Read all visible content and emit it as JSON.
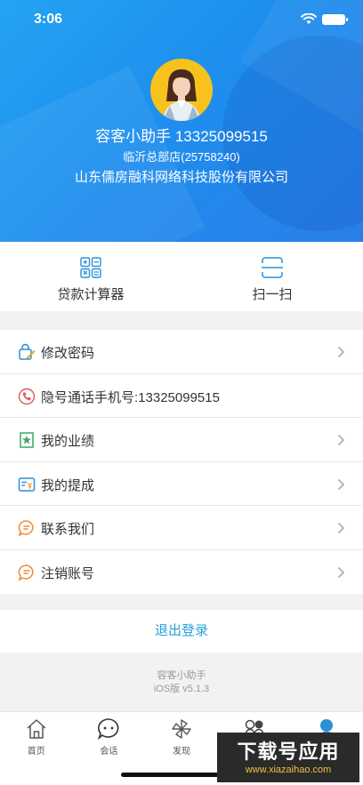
{
  "status_bar": {
    "time": "3:06"
  },
  "profile": {
    "name_line": "容客小助手  13325099515",
    "store": "临沂总部店(25758240)",
    "company": "山东儒房融科网络科技股份有限公司"
  },
  "tools": [
    {
      "label": "贷款计算器",
      "icon": "calculator-icon"
    },
    {
      "label": "扫一扫",
      "icon": "scan-icon"
    }
  ],
  "menu": [
    {
      "label": "修改密码",
      "icon": "edit-lock-icon",
      "arrow": true
    },
    {
      "label": "隐号通话手机号:13325099515",
      "icon": "phone-icon",
      "arrow": false
    },
    {
      "label": "我的业绩",
      "icon": "performance-icon",
      "arrow": true
    },
    {
      "label": "我的提成",
      "icon": "commission-icon",
      "arrow": true
    },
    {
      "label": "联系我们",
      "icon": "chat-icon",
      "arrow": true
    },
    {
      "label": "注销账号",
      "icon": "chat-icon",
      "arrow": true
    }
  ],
  "logout_label": "退出登录",
  "footer": {
    "app_name": "容客小助手",
    "version": "iOS版 v5.1.3"
  },
  "tabbar": [
    {
      "label": "首页",
      "icon": "home-icon"
    },
    {
      "label": "会话",
      "icon": "message-icon"
    },
    {
      "label": "发现",
      "icon": "pinwheel-icon"
    },
    {
      "label": "",
      "icon": "apps-icon"
    },
    {
      "label": "",
      "icon": "profile-icon",
      "active": true
    }
  ],
  "watermark": {
    "title": "下载号应用",
    "url": "www.xiazaihao.com"
  },
  "colors": {
    "header_blue": "#1e8fee",
    "accent": "#27a0d8",
    "avatar_bg": "#f8c21c"
  }
}
